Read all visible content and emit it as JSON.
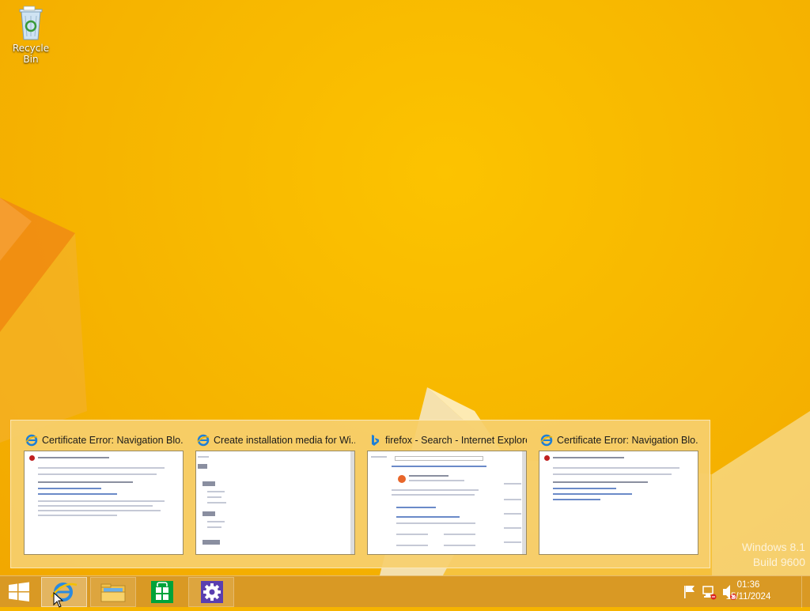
{
  "desktop": {
    "icons": [
      {
        "label": "Recycle Bin",
        "icon": "recycle-bin-icon"
      }
    ],
    "watermark": {
      "line1": "Windows 8.1",
      "line2": "Build 9600"
    }
  },
  "thumbnails": [
    {
      "title": "Certificate Error: Navigation Blo...",
      "icon": "ie-icon"
    },
    {
      "title": "Create installation media for Wi...",
      "icon": "ie-icon"
    },
    {
      "title": "firefox - Search - Internet Explorer",
      "icon": "bing-icon"
    },
    {
      "title": "Certificate Error: Navigation Blo...",
      "icon": "ie-icon"
    }
  ],
  "taskbar": {
    "buttons": [
      {
        "name": "start-button",
        "icon": "windows-logo-icon"
      },
      {
        "name": "internet-explorer-button",
        "icon": "ie-icon",
        "state": "active"
      },
      {
        "name": "file-explorer-button",
        "icon": "folder-icon"
      },
      {
        "name": "store-button",
        "icon": "store-icon"
      },
      {
        "name": "settings-button",
        "icon": "gear-icon"
      }
    ],
    "tray": {
      "icons": [
        "action-center-flag-icon",
        "network-icon",
        "volume-muted-icon"
      ],
      "time": "01:36",
      "date": "15/11/2024"
    }
  },
  "colors": {
    "background": "#f6b400",
    "taskbar": "#d69628",
    "strip": "#f6cf6e"
  }
}
